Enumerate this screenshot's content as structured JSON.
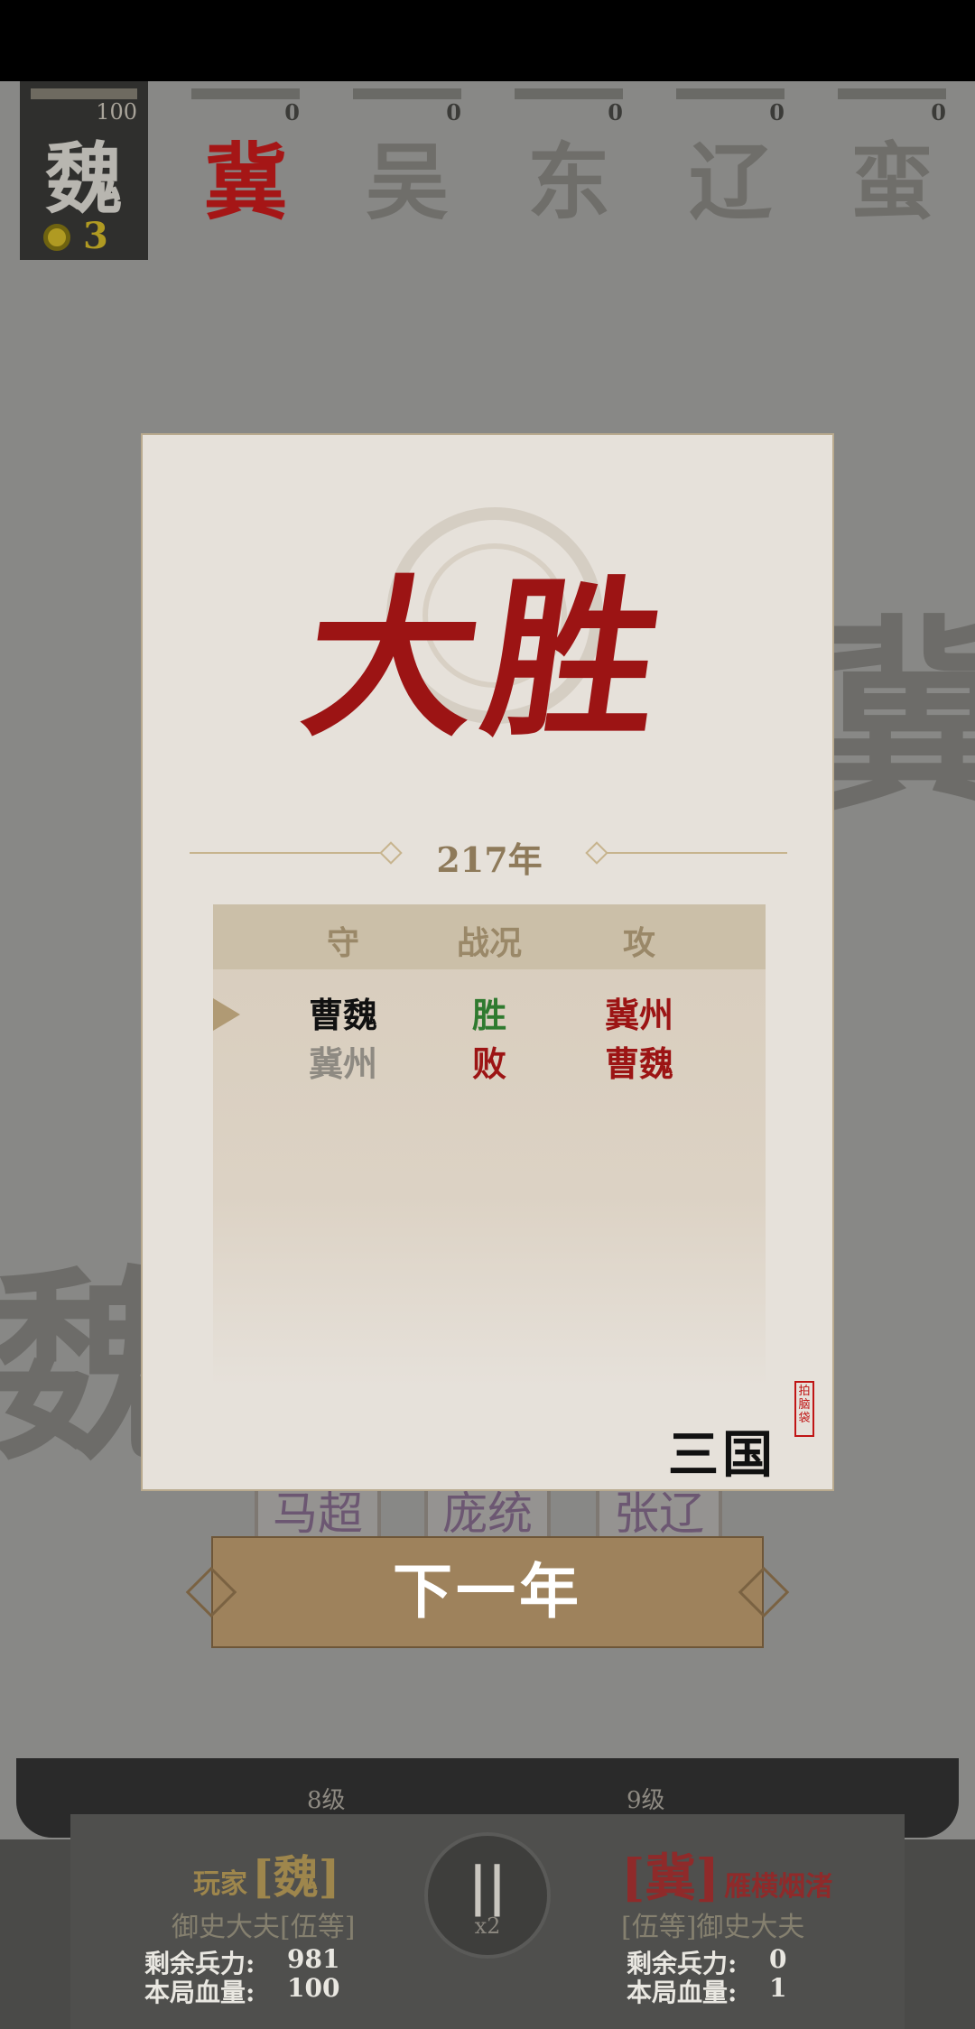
{
  "player_card": {
    "glyph": "魏",
    "bar_value": "100",
    "coins": "3"
  },
  "enemies": [
    {
      "glyph": "冀",
      "value": "0",
      "active": true
    },
    {
      "glyph": "吴",
      "value": "0"
    },
    {
      "glyph": "东",
      "value": "0"
    },
    {
      "glyph": "辽",
      "value": "0"
    },
    {
      "glyph": "蛮",
      "value": "0"
    }
  ],
  "background": {
    "left_char": "魏",
    "right_char": "冀"
  },
  "modal": {
    "result_title": "大胜",
    "year": "217年",
    "table": {
      "headers": [
        "守",
        "战况",
        "攻"
      ],
      "rows": [
        {
          "defender": "曹魏",
          "status": "胜",
          "attacker": "冀州",
          "selected": true
        },
        {
          "defender": "冀州",
          "status": "败",
          "attacker": "曹魏"
        }
      ]
    },
    "brand": "三国",
    "stamp": "拍脑袋"
  },
  "cards": [
    "马超",
    "庞统",
    "张辽"
  ],
  "next_button": "下一年",
  "levels": {
    "left": "8级",
    "right": "9级"
  },
  "player": {
    "prefix": "玩家",
    "name": "[魏]",
    "title": "御史大夫[伍等]",
    "troops_label": "剩余兵力:",
    "troops": "981",
    "hp_label": "本局血量:",
    "hp": "100"
  },
  "opponent": {
    "name": "[冀]",
    "nickname": "雁横烟渚",
    "title": "[伍等]御史大夫",
    "troops_label": "剩余兵力:",
    "troops": "0",
    "hp_label": "本局血量:",
    "hp": "1"
  },
  "controls": {
    "pause_icon": "pause-icon",
    "speed": "x2"
  }
}
